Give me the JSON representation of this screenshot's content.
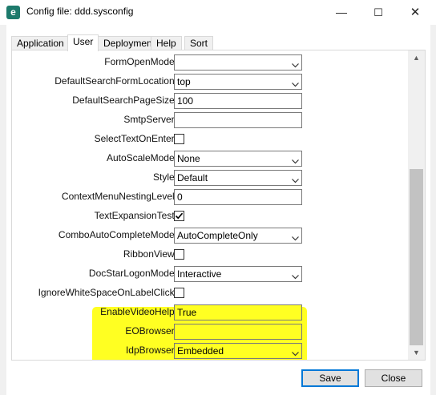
{
  "window": {
    "title": "Config file: ddd.sysconfig",
    "app_icon_letter": "e",
    "min_glyph": "—",
    "max_glyph": "☐",
    "close_glyph": "✕"
  },
  "tabs": [
    {
      "label": "Application",
      "active": false
    },
    {
      "label": "User",
      "active": true
    },
    {
      "label": "Deployment",
      "active": false
    },
    {
      "label": "Help",
      "active": false
    },
    {
      "label": "Sort",
      "active": false
    }
  ],
  "properties": [
    {
      "label": "FormOpenMode:",
      "type": "combo",
      "value": ""
    },
    {
      "label": "DefaultSearchFormLocation:",
      "type": "combo",
      "value": "top"
    },
    {
      "label": "DefaultSearchPageSize:",
      "type": "text",
      "value": "100"
    },
    {
      "label": "SmtpServer:",
      "type": "text",
      "value": ""
    },
    {
      "label": "SelectTextOnEnter:",
      "type": "check",
      "checked": false
    },
    {
      "label": "AutoScaleMode:",
      "type": "combo",
      "value": "None"
    },
    {
      "label": "Style:",
      "type": "combo",
      "value": "Default"
    },
    {
      "label": "ContextMenuNestingLevel:",
      "type": "text",
      "value": "0"
    },
    {
      "label": "TextExpansionTest:",
      "type": "check",
      "checked": true
    },
    {
      "label": "ComboAutoCompleteMode:",
      "type": "combo",
      "value": "AutoCompleteOnly"
    },
    {
      "label": "RibbonView:",
      "type": "check",
      "checked": false
    },
    {
      "label": "DocStarLogonMode:",
      "type": "combo",
      "value": "Interactive"
    },
    {
      "label": "IgnoreWhiteSpaceOnLabelClick:",
      "type": "check",
      "checked": false
    },
    {
      "label": "EnableVideoHelp:",
      "type": "text",
      "value": "True",
      "highlight": true
    },
    {
      "label": "EOBrowser:",
      "type": "text",
      "value": "",
      "highlight": true
    },
    {
      "label": "IdpBrowser:",
      "type": "combo",
      "value": "Embedded",
      "highlight": true
    }
  ],
  "buttons": {
    "save": "Save",
    "close": "Close"
  },
  "colors": {
    "highlight": "#ffff22",
    "accent": "#0078d7"
  }
}
